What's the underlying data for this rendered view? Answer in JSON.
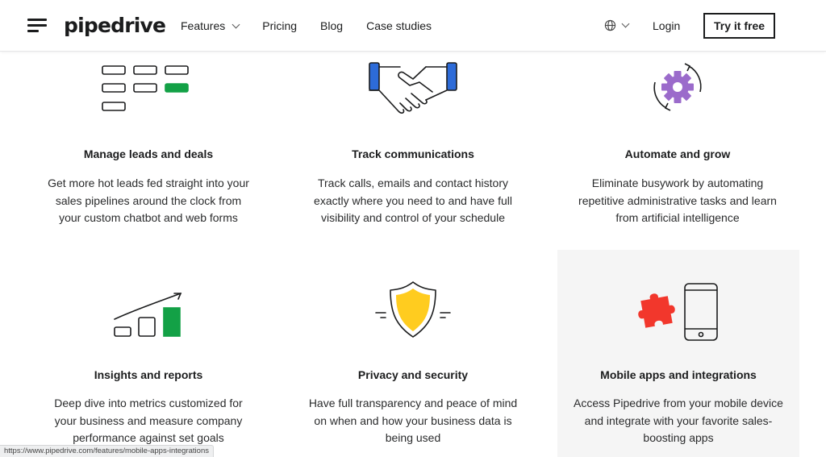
{
  "header": {
    "logo": "pipedrive",
    "nav": [
      {
        "label": "Features",
        "has_dropdown": true
      },
      {
        "label": "Pricing"
      },
      {
        "label": "Blog"
      },
      {
        "label": "Case studies"
      }
    ],
    "language_icon": "globe-icon",
    "login": "Login",
    "cta": "Try it free"
  },
  "colors": {
    "green": "#13a146",
    "blue": "#2d6bd8",
    "purple": "#9b6bcb",
    "yellow": "#ffcc1f",
    "red": "#f2372c",
    "highlight_bg": "#f5f5f5"
  },
  "features": [
    {
      "icon": "pipeline-icon",
      "title": "Manage leads and deals",
      "description": "Get more hot leads fed straight into your sales pipelines around the clock from your custom chatbot and web forms"
    },
    {
      "icon": "handshake-icon",
      "title": "Track communications",
      "description": "Track calls, emails and contact history exactly where you need to and have full visibility and control of your schedule"
    },
    {
      "icon": "gear-cycle-icon",
      "title": "Automate and grow",
      "description": "Eliminate busywork by automating repetitive administrative tasks and learn from artificial intelligence"
    },
    {
      "icon": "growth-chart-icon",
      "title": "Insights and reports",
      "description": "Deep dive into metrics customized for your business and measure company performance against set goals"
    },
    {
      "icon": "shield-icon",
      "title": "Privacy and security",
      "description": "Have full transparency and peace of mind on when and how your business data is being used"
    },
    {
      "icon": "puzzle-phone-icon",
      "title": "Mobile apps and integrations",
      "description": "Access Pipedrive from your mobile device and integrate with your favorite sales-boosting apps"
    }
  ],
  "status_bar": {
    "url": "https://www.pipedrive.com/features/mobile-apps-integrations"
  }
}
